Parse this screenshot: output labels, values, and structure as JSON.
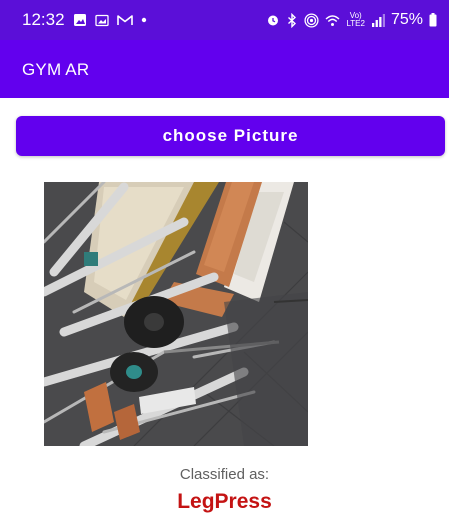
{
  "status_bar": {
    "time": "12:32",
    "left_icons": [
      "image-icon",
      "gallery-icon",
      "gmail-icon",
      "dot-icon"
    ],
    "right_icons": [
      "alarm-icon",
      "bluetooth-icon",
      "hotspot-icon",
      "wifi-icon",
      "volte-icon",
      "signal-icon",
      "battery-icon"
    ],
    "volte_label": "Vo)",
    "lte_label": "LTE2",
    "battery": "75%"
  },
  "app_bar": {
    "title": "GYM AR"
  },
  "choose_button": {
    "label": "choose Picture"
  },
  "result": {
    "label": "Classified as:",
    "value": "LegPress"
  },
  "colors": {
    "status_bar": "#5b0fd8",
    "primary": "#6200ee",
    "result_text": "#c41313",
    "label_text": "#606060"
  }
}
